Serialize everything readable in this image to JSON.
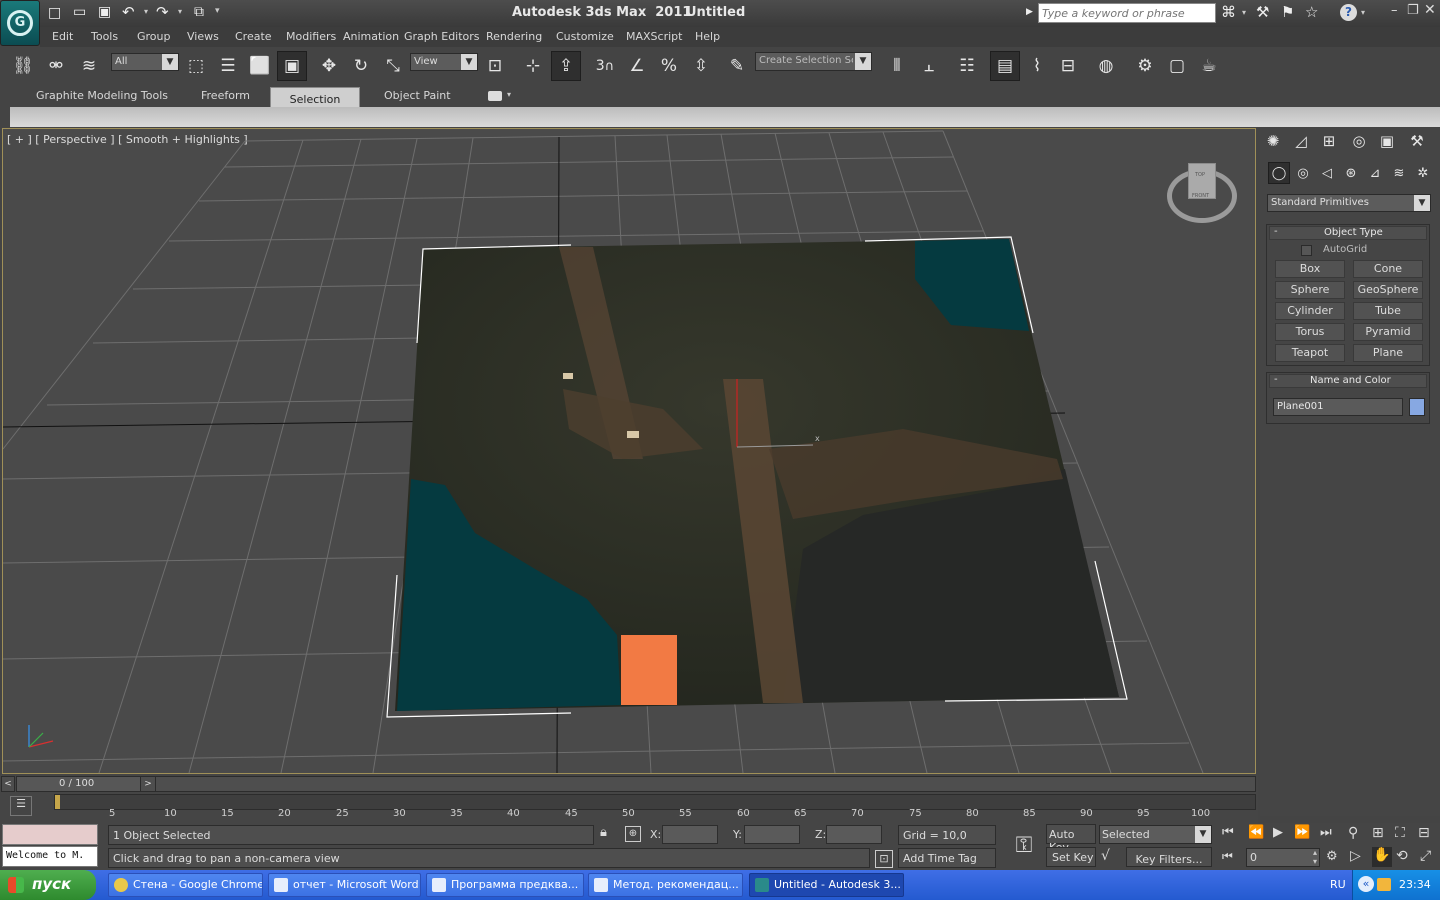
{
  "titlebar": {
    "app_title": "Autodesk 3ds Max  2011",
    "doc_title": "Untitled",
    "search_placeholder": "Type a keyword or phrase"
  },
  "menu": [
    "Edit",
    "Tools",
    "Group",
    "Views",
    "Create",
    "Modifiers",
    "Animation",
    "Graph Editors",
    "Rendering",
    "Customize",
    "MAXScript",
    "Help"
  ],
  "toolbar": {
    "selection_filter": "All",
    "ref_coord": "View",
    "named_selection": "Create Selection Se",
    "snap_angle_label": "3"
  },
  "ribbon": {
    "tabs": [
      "Graphite Modeling Tools",
      "Freeform",
      "Selection",
      "Object Paint"
    ],
    "active_tab": "Selection"
  },
  "viewport": {
    "label": "[ + ] [ Perspective ] [ Smooth + Highlights ]",
    "viewcube_top": "TOP",
    "viewcube_front": "FRONT"
  },
  "command_panel": {
    "category": "Standard Primitives",
    "object_type_title": "Object Type",
    "autogrid_label": "AutoGrid",
    "buttons": [
      "Box",
      "Cone",
      "Sphere",
      "GeoSphere",
      "Cylinder",
      "Tube",
      "Torus",
      "Pyramid",
      "Teapot",
      "Plane"
    ],
    "name_color_title": "Name and Color",
    "object_name": "Plane001",
    "object_color": "#87a8e2"
  },
  "timeline": {
    "frame_display": "0 / 100",
    "ticks": [
      "5",
      "10",
      "15",
      "20",
      "25",
      "30",
      "35",
      "40",
      "45",
      "50",
      "55",
      "60",
      "65",
      "70",
      "75",
      "80",
      "85",
      "90",
      "95",
      "100"
    ]
  },
  "status": {
    "maxscript_listener": "Welcome to M.",
    "selection_info": "1 Object Selected",
    "prompt": "Click and drag to pan a non-camera view",
    "x_label": "X:",
    "y_label": "Y:",
    "z_label": "Z:",
    "grid": "Grid = 10,0",
    "add_time_tag": "Add Time Tag",
    "auto_key": "Auto Key",
    "set_key": "Set Key",
    "key_mode": "Selected",
    "key_filters": "Key Filters...",
    "current_frame": "0"
  },
  "taskbar": {
    "start_label": "пуск",
    "tasks": [
      {
        "label": "Стена - Google Chrome"
      },
      {
        "label": "отчет - Microsoft Word"
      },
      {
        "label": "Программа предква..."
      },
      {
        "label": "Метод. рекомендац..."
      },
      {
        "label": "Untitled - Autodesk 3..."
      }
    ],
    "language": "RU",
    "clock": "23:34"
  },
  "colors": {
    "viewport_border": "#a09058",
    "taskbar_blue": "#245ad0",
    "start_green": "#3c9a3c",
    "selection_box": "#ffffff"
  }
}
